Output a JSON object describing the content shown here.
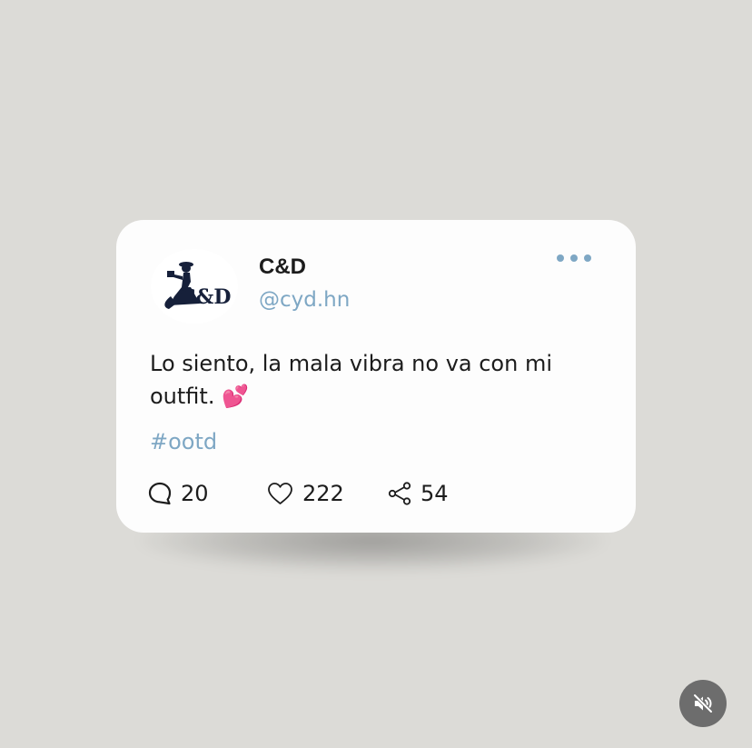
{
  "post": {
    "author_name": "C&D",
    "author_handle": "@cyd.hn",
    "avatar_logo_text": "C&D",
    "text": "Lo siento, la mala vibra no va con mi outfit. 💕",
    "hashtag": "#ootd",
    "more_icon": "more-horizontal-icon"
  },
  "actions": {
    "comments": "20",
    "likes": "222",
    "shares": "54",
    "comment_icon": "comment-bubble-icon",
    "like_icon": "heart-outline-icon",
    "share_icon": "share-nodes-icon"
  },
  "media_control": {
    "icon": "speaker-muted-icon"
  },
  "colors": {
    "background": "#dcdbd7",
    "card": "#fdfdfd",
    "accent": "#7ea7c4",
    "text": "#1c1c1c",
    "logo": "#16203a",
    "mute_button": "#6d6d6d"
  }
}
